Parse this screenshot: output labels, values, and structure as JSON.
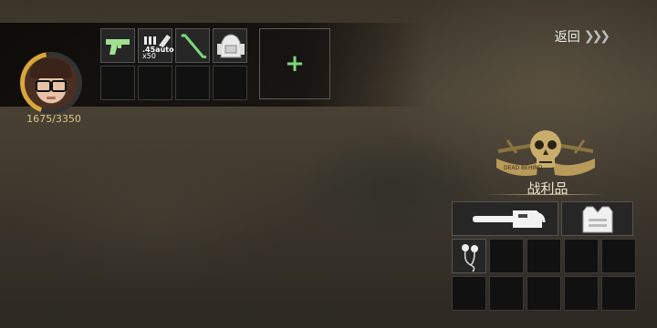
{
  "player": {
    "hp_text": "1675/3350",
    "avatar_icon": "female-survivor-with-glasses-avatar",
    "hp_ring_color": "#d9a63a"
  },
  "inventory": {
    "slots": [
      {
        "icon": "pistol-icon",
        "label": ""
      },
      {
        "icon": "ammo-icon",
        "label": ".45auto",
        "qty": "x50"
      },
      {
        "icon": "crowbar-icon",
        "label": ""
      },
      {
        "icon": "backpack-icon",
        "label": ""
      },
      {
        "icon": "",
        "label": ""
      },
      {
        "icon": "",
        "label": ""
      },
      {
        "icon": "",
        "label": ""
      },
      {
        "icon": "",
        "label": ""
      }
    ],
    "add_icon": "plus-icon",
    "accent_color": "#7fd67a"
  },
  "nav": {
    "back_label": "返回",
    "back_icon": "triple-chevron-right-icon"
  },
  "loot": {
    "title": "战利品",
    "emblem_text": "DEAD BEHIND",
    "items": [
      {
        "icon": "chainsaw-icon"
      },
      {
        "icon": "body-armor-vest-icon"
      },
      {
        "icon": "earphones-icon"
      }
    ]
  }
}
